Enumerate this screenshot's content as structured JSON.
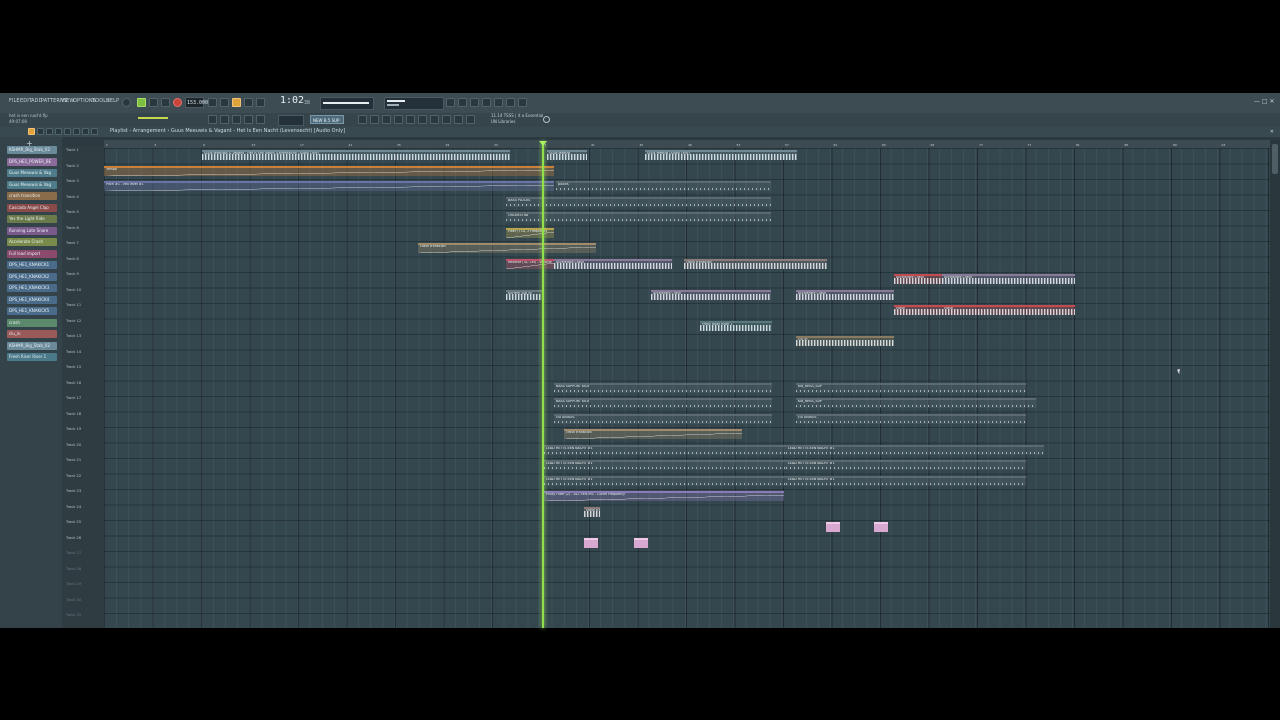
{
  "menu": [
    "FILE",
    "EDIT",
    "ADD",
    "PATTERNS",
    "VIEW",
    "OPTIONS",
    "TOOLS",
    "HELP"
  ],
  "project": {
    "file": "het is een nacht.flp",
    "time_small": "49:07:08"
  },
  "transport": {
    "tempo": "153.000",
    "time": "1:02",
    "time_sub": "38",
    "snap": "NEW B.5 SUP"
  },
  "hint": {
    "line1": "11.14  TSSS | it a Essential",
    "line2": "UN Libraries"
  },
  "playlist_title": "Playlist - Arrangement › Guus Meeuwis & Vagant - Het Is Een Nacht (Levensecht) [Audio Only]",
  "channels": [
    {
      "label": "KSHMR_Big_Stab_02",
      "color": "#6b8a9a"
    },
    {
      "label": "DPS_HE1_POWER_BE",
      "color": "#8b6b9a"
    },
    {
      "label": "Guus Meeuwis & Vag",
      "color": "#4f7c8a"
    },
    {
      "label": "Guus Meeuwis & Vag",
      "color": "#4f7c8a"
    },
    {
      "label": "crash transition",
      "color": "#8a6b4a"
    },
    {
      "label": "Cascada Angel Clap",
      "color": "#8a4a4a"
    },
    {
      "label": "Yes the Light Ride",
      "color": "#6b7a4a"
    },
    {
      "label": "Running Late Snare",
      "color": "#7a5a8a"
    },
    {
      "label": "Accelerate Crash",
      "color": "#7a8a4a"
    },
    {
      "label": "Full lead import",
      "color": "#8a4a6b"
    },
    {
      "label": "DPS_HE1_KNAKICK1",
      "color": "#4a6b8a"
    },
    {
      "label": "DPS_HE1_KNAKICK2",
      "color": "#4a6b8a"
    },
    {
      "label": "DPS_HE1_KNAKICK3",
      "color": "#4a6b8a"
    },
    {
      "label": "DPS_HE1_KNAKICK4",
      "color": "#4a6b8a"
    },
    {
      "label": "DPS_HE1_KNAKICK5",
      "color": "#4a6b8a"
    },
    {
      "label": "crash",
      "color": "#5a8a6b"
    },
    {
      "label": "clu_in",
      "color": "#9a5a5a"
    },
    {
      "label": "KSHMR_Big_Stab_02",
      "color": "#6b8a9a"
    },
    {
      "label": "Fresh Riser Riser 1",
      "color": "#4a7a8a"
    }
  ],
  "tracks": [
    "Track 1",
    "Track 2",
    "Track 3",
    "Track 4",
    "Track 5",
    "Track 6",
    "Track 7",
    "Track 8",
    "Track 9",
    "Track 10",
    "Track 11",
    "Track 12",
    "Track 13",
    "Track 14",
    "Track 15",
    "Track 16",
    "Track 17",
    "Track 18",
    "Track 19",
    "Track 20",
    "Track 21",
    "Track 22",
    "Track 23",
    "Track 24",
    "Track 25",
    "Track 26",
    "Track 27",
    "Track 28",
    "Track 29",
    "Track 30",
    "Track 31"
  ],
  "ruler": [
    "1",
    "5",
    "9",
    "13",
    "17",
    "21",
    "25",
    "29",
    "33",
    "37",
    "41",
    "45",
    "49",
    "53",
    "57",
    "61",
    "65",
    "69",
    "73",
    "77",
    "81",
    "85",
    "89",
    "93"
  ],
  "clips": [
    {
      "label": "Guus Meeuwis & Vagant - Het Is Een Nacht (Levensecht) [Audio Only]",
      "kind": "wave",
      "color": "#6f8894"
    },
    {
      "label": "Guus Meeuw",
      "kind": "wave",
      "color": "#6f8894"
    },
    {
      "label": "Guus Meeuw (Audio Only)",
      "kind": "wave",
      "color": "#6f8894"
    },
    {
      "label": "Tempo",
      "kind": "auto",
      "color": "#c9813a"
    },
    {
      "label": "Pitch #1 - Mix level #1",
      "kind": "auto",
      "color": "#6a72a8"
    },
    {
      "label": "plucks",
      "kind": "pat",
      "color": "#5a6a70"
    },
    {
      "label": "BASS PLUCKS",
      "kind": "pat",
      "color": "#5a6a70"
    },
    {
      "label": "ORCHESTRA",
      "kind": "pat",
      "color": "#5a6a70"
    },
    {
      "label": "Filter (TTD, 2 Frequency",
      "kind": "auto",
      "color": "#b8a44a"
    },
    {
      "label": "crash transition",
      "kind": "auto",
      "color": "#a08a6a"
    },
    {
      "label": "Reverse (3L, CM) - Volume",
      "kind": "auto",
      "color": "#c0506a"
    },
    {
      "label": "Accelerate Crash",
      "kind": "wave",
      "color": "#8a7a9a"
    },
    {
      "label": "crash transition",
      "kind": "wave",
      "color": "#8a7a7a"
    },
    {
      "label": "Accelerate Crash",
      "kind": "wave",
      "color": "#c44a52"
    },
    {
      "label": "crash",
      "kind": "wave",
      "color": "#c44a52"
    },
    {
      "label": "Accelerate Crash",
      "kind": "wave",
      "color": "#8a7a9a"
    },
    {
      "label": "KSHMR_Big_St",
      "kind": "wave",
      "color": "#6a7a80"
    },
    {
      "label": "Fresh Riser Riser 1",
      "kind": "wave",
      "color": "#5a7a80"
    },
    {
      "label": "clu_in",
      "kind": "wave",
      "color": "#8a7a60"
    },
    {
      "label": "BASS SUPPORT KICK",
      "kind": "pat",
      "color": "#5a6a70"
    },
    {
      "label": "Kla_RHSS_SUP",
      "kind": "pat",
      "color": "#5a6a70"
    },
    {
      "label": "clu UNIXOS",
      "kind": "pat",
      "color": "#5a6a70"
    },
    {
      "label": "LEAD HET IS EEN NACHT #1",
      "kind": "pat",
      "color": "#5a6a70"
    },
    {
      "label": "LEAD HET IS EEN NACHT #1",
      "kind": "pat",
      "color": "#5a6a70"
    },
    {
      "label": "Fruity Filter (2) - ALL SYNTHS - Cutoff Frequency",
      "kind": "auto",
      "color": "#8a7ab8"
    }
  ]
}
